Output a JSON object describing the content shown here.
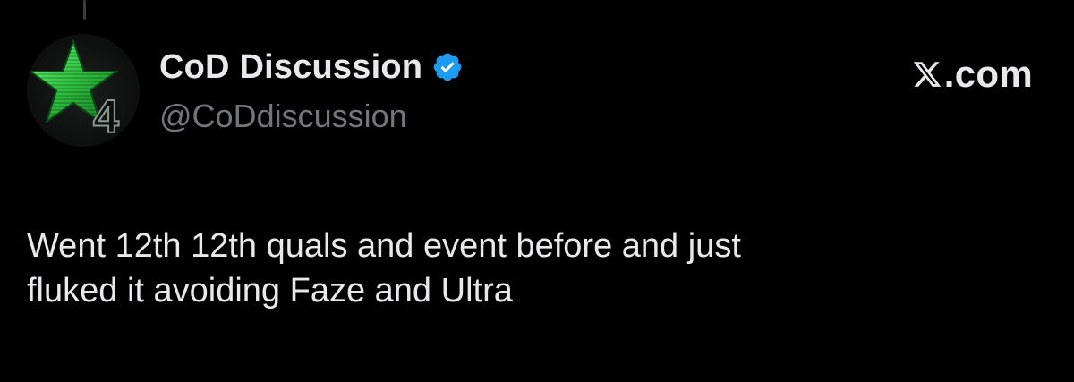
{
  "tweet": {
    "author": {
      "display_name": "CoD Discussion",
      "handle": "@CoDdiscussion",
      "verified": true,
      "avatar_icon": "green-star-4-avatar"
    },
    "brand": {
      "icon": "x-logo-icon",
      "text": ".com"
    },
    "text": "Went 12th 12th quals and event before and just\nfluked it avoiding Faze and Ultra"
  },
  "colors": {
    "background": "#000000",
    "primary_text": "#e7e9ea",
    "secondary_text": "#71767b",
    "verified_badge": "#1d9bf0",
    "avatar_star": "#2ecc40"
  }
}
